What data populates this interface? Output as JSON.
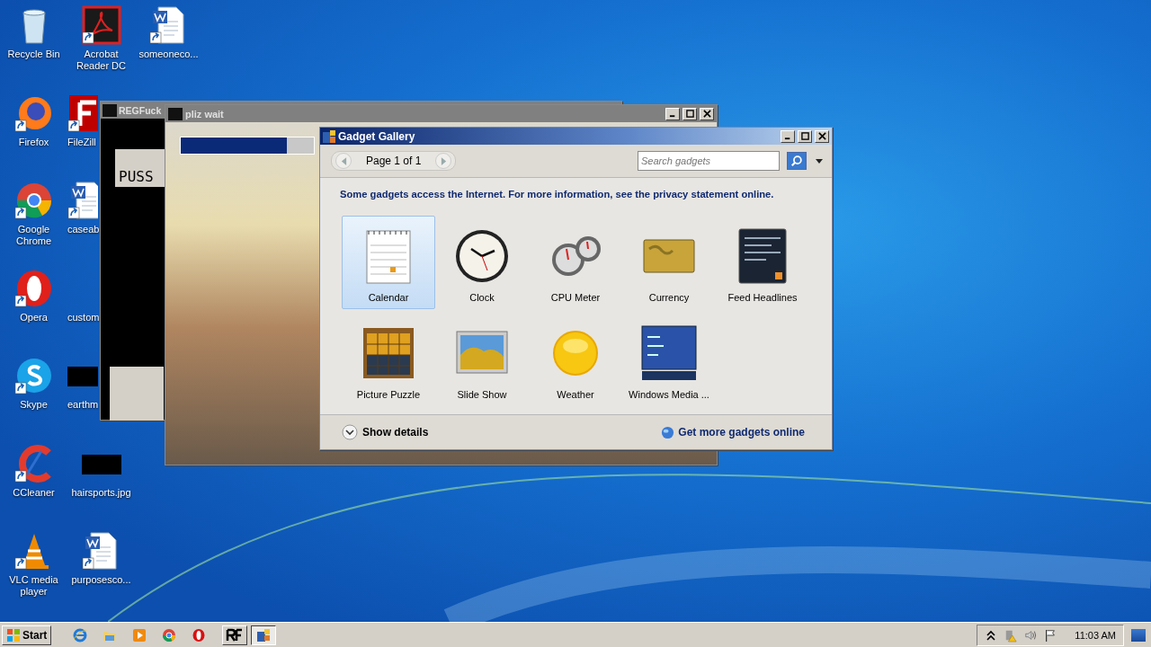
{
  "desktop_icons": [
    {
      "label": "Recycle Bin",
      "kind": "recycle"
    },
    {
      "label": "Firefox",
      "kind": "firefox"
    },
    {
      "label": "Google Chrome",
      "kind": "chrome"
    },
    {
      "label": "Opera",
      "kind": "opera"
    },
    {
      "label": "Skype",
      "kind": "skype"
    },
    {
      "label": "CCleaner",
      "kind": "ccleaner"
    },
    {
      "label": "VLC media player",
      "kind": "vlc"
    },
    {
      "label": "Acrobat Reader DC",
      "kind": "pdf"
    },
    {
      "label": "FileZill",
      "kind": "filezilla"
    },
    {
      "label": "caseab",
      "kind": "word"
    },
    {
      "label": "custom",
      "kind": "none"
    },
    {
      "label": "earthm",
      "kind": "thumb"
    },
    {
      "label": "hairsports.jpg",
      "kind": "thumb"
    },
    {
      "label": "purposesco...",
      "kind": "word"
    },
    {
      "label": "someoneco...",
      "kind": "word"
    }
  ],
  "reg_window": {
    "title": "REGFuck",
    "text": "PUSS"
  },
  "wait_window": {
    "title": "pliz wait",
    "progress": {
      "level": 0.8
    }
  },
  "gadget_gallery": {
    "title": "Gadget Gallery",
    "page_label": "Page 1 of 1",
    "search": {
      "placeholder": "Search gadgets"
    },
    "notice": "Some gadgets access the Internet.  For more information, see the privacy statement online.",
    "gadgets": [
      {
        "name": "Calendar",
        "kind": "calendar",
        "selected": true
      },
      {
        "name": "Clock",
        "kind": "clock",
        "selected": false
      },
      {
        "name": "CPU Meter",
        "kind": "meter",
        "selected": false
      },
      {
        "name": "Currency",
        "kind": "currency",
        "selected": false
      },
      {
        "name": "Feed Headlines",
        "kind": "feed",
        "selected": false
      },
      {
        "name": "Picture Puzzle",
        "kind": "puzzle",
        "selected": false
      },
      {
        "name": "Slide Show",
        "kind": "slideshow",
        "selected": false
      },
      {
        "name": "Weather",
        "kind": "weather",
        "selected": false
      },
      {
        "name": "Windows Media ...",
        "kind": "media",
        "selected": false
      }
    ],
    "details_label": "Show details",
    "more_link": "Get more gadgets online"
  },
  "taskbar": {
    "start_label": "Start",
    "quick_launch": [
      {
        "kind": "ie"
      },
      {
        "kind": "folder"
      },
      {
        "kind": "player"
      },
      {
        "kind": "chrome"
      },
      {
        "kind": "opera"
      }
    ],
    "tasks": [
      {
        "kind": "rf",
        "selected": false
      },
      {
        "kind": "gadget",
        "selected": true
      }
    ],
    "clock": "11:03 AM"
  }
}
